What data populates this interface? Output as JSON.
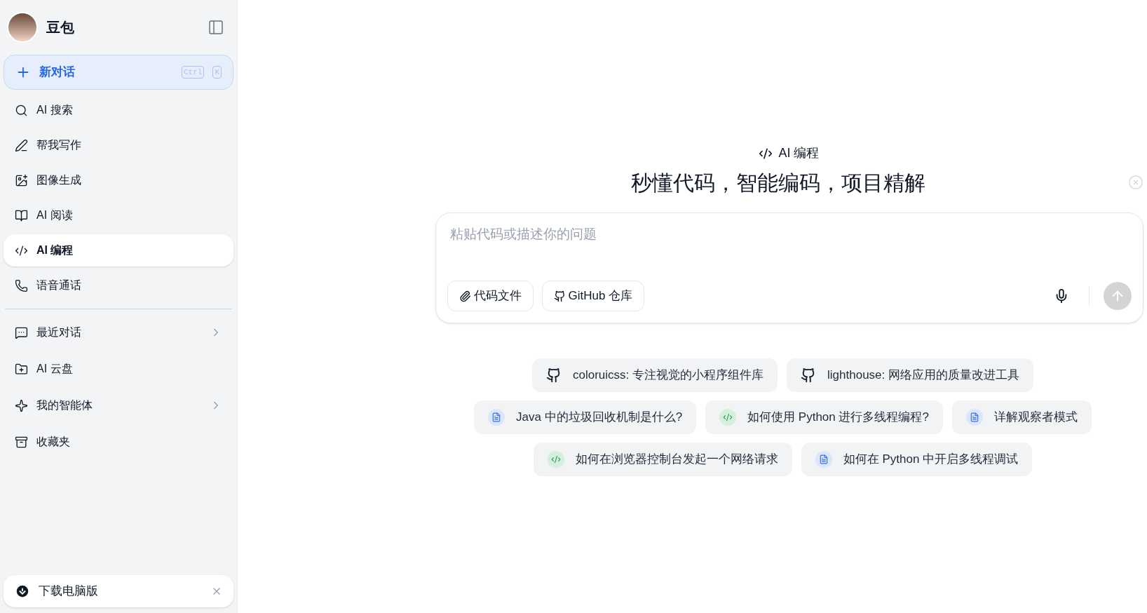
{
  "sidebar": {
    "app_name": "豆包",
    "new_chat": {
      "label": "新对话",
      "shortcut": [
        "Ctrl",
        "K"
      ]
    },
    "items": [
      {
        "kind": "search",
        "label": "AI 搜索",
        "selected": false,
        "has_submenu": false
      },
      {
        "kind": "write",
        "label": "帮我写作",
        "selected": false,
        "has_submenu": false
      },
      {
        "kind": "image",
        "label": "图像生成",
        "selected": false,
        "has_submenu": false
      },
      {
        "kind": "read",
        "label": "AI 阅读",
        "selected": false,
        "has_submenu": false
      },
      {
        "kind": "code",
        "label": "AI 编程",
        "selected": true,
        "has_submenu": false
      },
      {
        "kind": "call",
        "label": "语音通话",
        "selected": false,
        "has_submenu": false
      }
    ],
    "lower_items": [
      {
        "kind": "chat",
        "label": "最近对话",
        "selected": false,
        "has_submenu": true
      },
      {
        "kind": "cloud",
        "label": "AI 云盘",
        "selected": false,
        "has_submenu": false
      },
      {
        "kind": "agent",
        "label": "我的智能体",
        "selected": false,
        "has_submenu": true
      },
      {
        "kind": "favorites",
        "label": "收藏夹",
        "selected": false,
        "has_submenu": false
      }
    ],
    "download": {
      "label": "下载电脑版"
    }
  },
  "main": {
    "mode_label": "AI 编程",
    "headline": "秒懂代码，智能编码，项目精解",
    "input": {
      "placeholder": "粘贴代码或描述你的问题",
      "buttons": [
        {
          "kind": "file",
          "label": "代码文件"
        },
        {
          "kind": "github",
          "label": "GitHub 仓库"
        }
      ]
    },
    "suggestions": [
      [
        {
          "kind": "github",
          "label": "coloruicss: 专注视觉的小程序组件库"
        },
        {
          "kind": "github",
          "label": "lighthouse: 网络应用的质量改进工具"
        }
      ],
      [
        {
          "kind": "doc",
          "label": "Java 中的垃圾回收机制是什么?"
        },
        {
          "kind": "code",
          "label": "如何使用 Python 进行多线程编程?"
        },
        {
          "kind": "doc",
          "label": "详解观察者模式"
        }
      ],
      [
        {
          "kind": "code",
          "label": "如何在浏览器控制台发起一个网络请求"
        },
        {
          "kind": "doc",
          "label": "如何在 Python 中开启多线程调试"
        }
      ]
    ]
  }
}
